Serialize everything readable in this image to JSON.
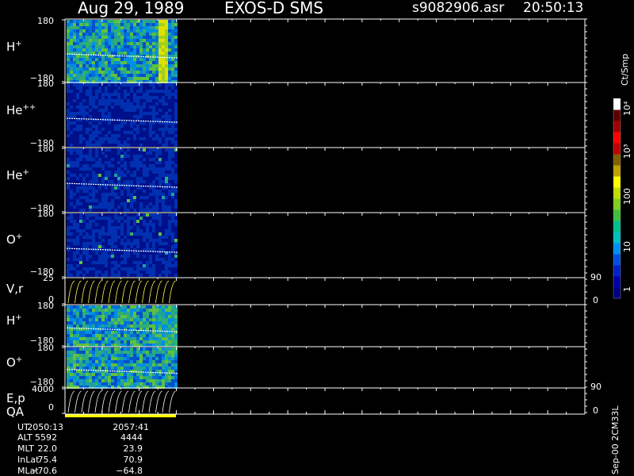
{
  "header": {
    "date": "Aug 29, 1989",
    "instrument": "EXOS-D SMS",
    "file": "s9082906.asr",
    "time": "20:50:13"
  },
  "panels": [
    {
      "id": "h-plus-1",
      "label": "H",
      "sup": "+",
      "top": "180",
      "bottom": "−180"
    },
    {
      "id": "he-pp",
      "label": "He",
      "sup": "++",
      "top": "180",
      "bottom": "−180"
    },
    {
      "id": "he-plus",
      "label": "He",
      "sup": "+",
      "top": "180",
      "bottom": "−180"
    },
    {
      "id": "o-plus-1",
      "label": "O",
      "sup": "+",
      "top": "180",
      "bottom": "−180"
    },
    {
      "id": "vr",
      "label": "V,r",
      "sup": "",
      "top": "25",
      "bottom": "0"
    },
    {
      "id": "h-plus-2",
      "label": "H",
      "sup": "+",
      "top": "180",
      "bottom": "−180"
    },
    {
      "id": "o-plus-2",
      "label": "O",
      "sup": "+",
      "top": "180",
      "bottom": "−180"
    },
    {
      "id": "ep",
      "label": "E,p",
      "sup": "",
      "top": "4000",
      "bottom": "0"
    }
  ],
  "qa_label": "QA",
  "right_axis": {
    "vr_top": "90",
    "vr_bottom": "0",
    "ep_top": "90",
    "ep_bottom": "0"
  },
  "colorbar": {
    "units": "Ct/Smp",
    "ticks": [
      "1",
      "10",
      "100",
      "10³",
      "10⁴"
    ],
    "colors": [
      "#000080",
      "#0000a8",
      "#0020c8",
      "#0050e0",
      "#0090f0",
      "#00c0c0",
      "#00c090",
      "#40c040",
      "#80d020",
      "#c0e000",
      "#ffff00",
      "#c0a000",
      "#806000",
      "#c00000",
      "#ff0000",
      "#a00000",
      "#600000",
      "#ffffff"
    ]
  },
  "footer": {
    "rows": [
      {
        "label": "UT",
        "v1": "2050:13",
        "v2": "2057:41"
      },
      {
        "label": "ALT",
        "v1": "5592",
        "v2": "4444"
      },
      {
        "label": "MLT",
        "v1": "22.0",
        "v2": "23.9"
      },
      {
        "label": "InLat",
        "v1": "75.4",
        "v2": "70.9"
      },
      {
        "label": "MLat",
        "v1": "−70.6",
        "v2": "−64.8"
      }
    ],
    "side": "Sep-00 2CM33L"
  }
}
